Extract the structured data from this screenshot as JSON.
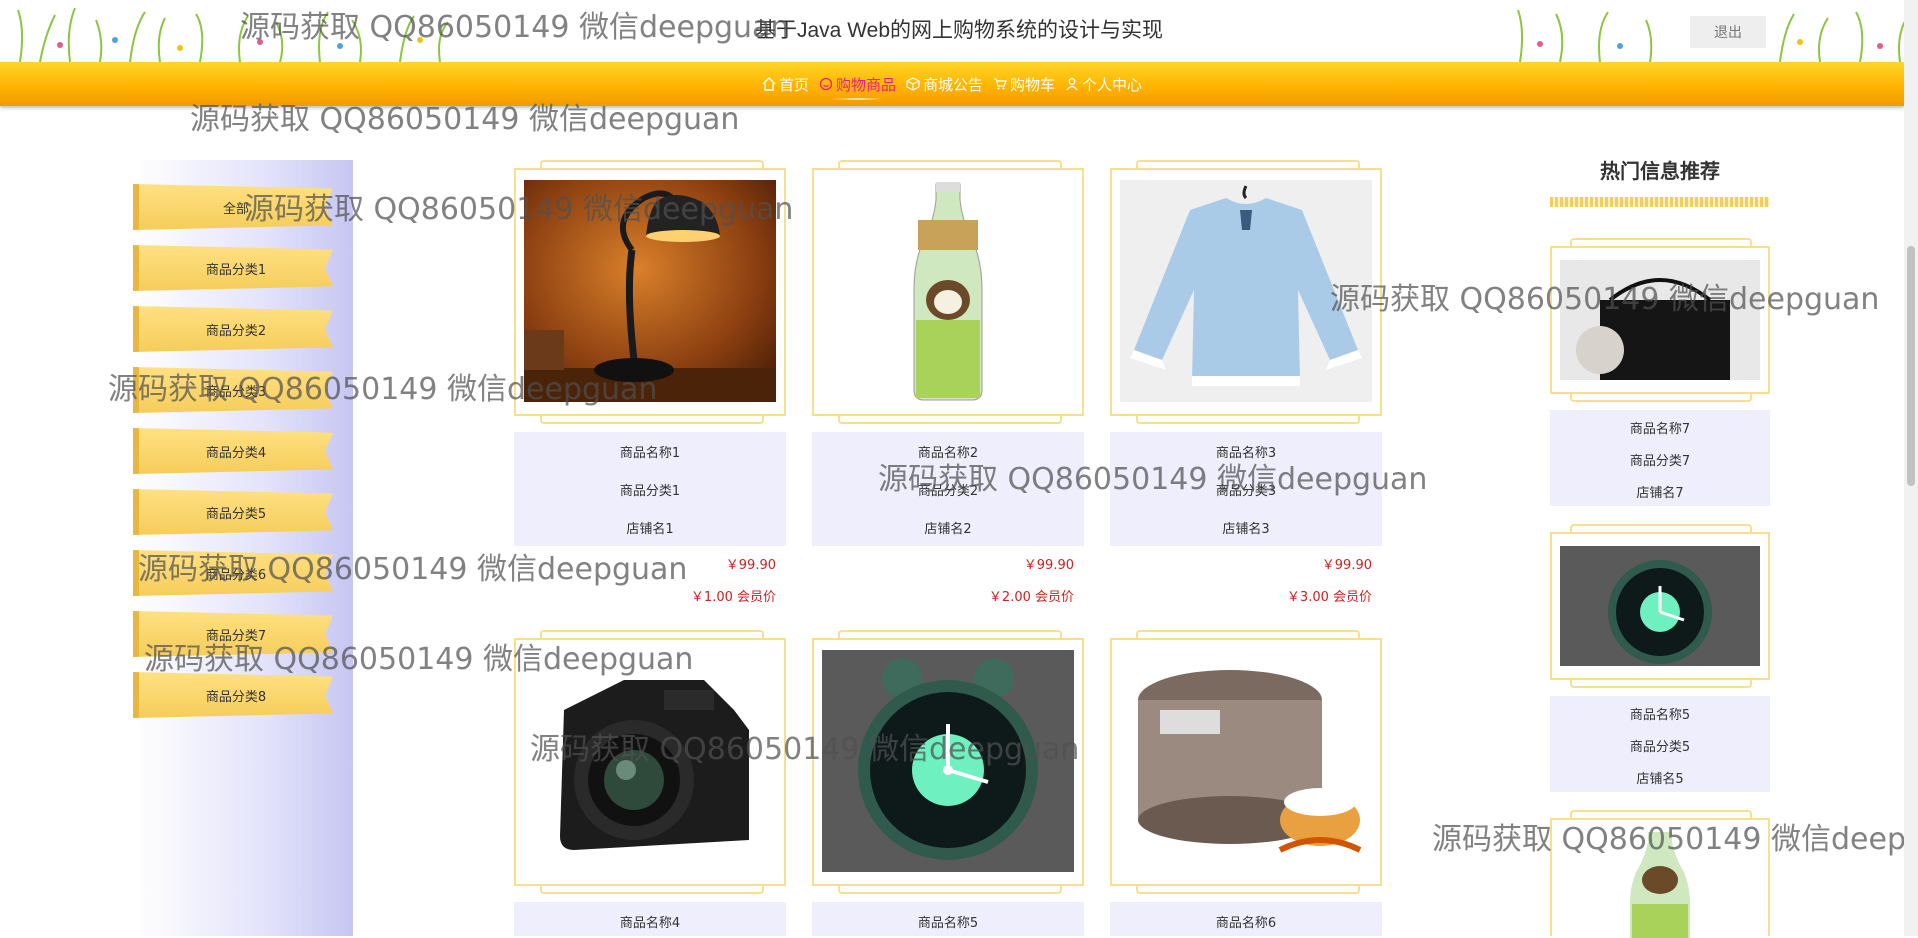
{
  "header": {
    "title": "基于Java Web的网上购物系统的设计与实现",
    "logout_label": "退出"
  },
  "nav": {
    "items": [
      {
        "label": "首页",
        "icon": "home-icon"
      },
      {
        "label": "购物商品",
        "icon": "smile-icon",
        "active": true
      },
      {
        "label": "商城公告",
        "icon": "box-icon"
      },
      {
        "label": "购物车",
        "icon": "cart-icon"
      },
      {
        "label": "个人中心",
        "icon": "user-icon"
      }
    ]
  },
  "sidebar": {
    "categories": [
      "全部",
      "商品分类1",
      "商品分类2",
      "商品分类3",
      "商品分类4",
      "商品分类5",
      "商品分类6",
      "商品分类7",
      "商品分类8"
    ]
  },
  "products": [
    {
      "name": "商品名称1",
      "category": "商品分类1",
      "shop": "店铺名1",
      "price": "￥99.90",
      "member_price": "￥1.00 会员价",
      "image": "desk-lamp"
    },
    {
      "name": "商品名称2",
      "category": "商品分类2",
      "shop": "店铺名2",
      "price": "￥99.90",
      "member_price": "￥2.00 会员价",
      "image": "coconut-drink-bottle"
    },
    {
      "name": "商品名称3",
      "category": "商品分类3",
      "shop": "店铺名3",
      "price": "￥99.90",
      "member_price": "￥3.00 会员价",
      "image": "blue-blouse"
    },
    {
      "name": "商品名称4",
      "image": "canon-camera"
    },
    {
      "name": "商品名称5",
      "image": "alarm-clock"
    },
    {
      "name": "商品名称6",
      "image": "rice-cooker"
    }
  ],
  "recommend": {
    "title": "热门信息推荐",
    "items": [
      {
        "name": "商品名称7",
        "category": "商品分类7",
        "shop": "店铺名7",
        "image": "black-handbag"
      },
      {
        "name": "商品名称5",
        "category": "商品分类5",
        "shop": "店铺名5",
        "image": "alarm-clock"
      },
      {
        "image": "coconut-drink-bottle"
      }
    ]
  },
  "watermark_text": "源码获取 QQ86050149 微信deepguan",
  "watermark_partial": "源码获取 QQ86050149 微信deepgu",
  "colors": {
    "nav": "#ffb400",
    "accent": "#e91e8c",
    "price": "#cc2222",
    "card_info": "#eeeefc",
    "frame": "#f8df8e"
  }
}
